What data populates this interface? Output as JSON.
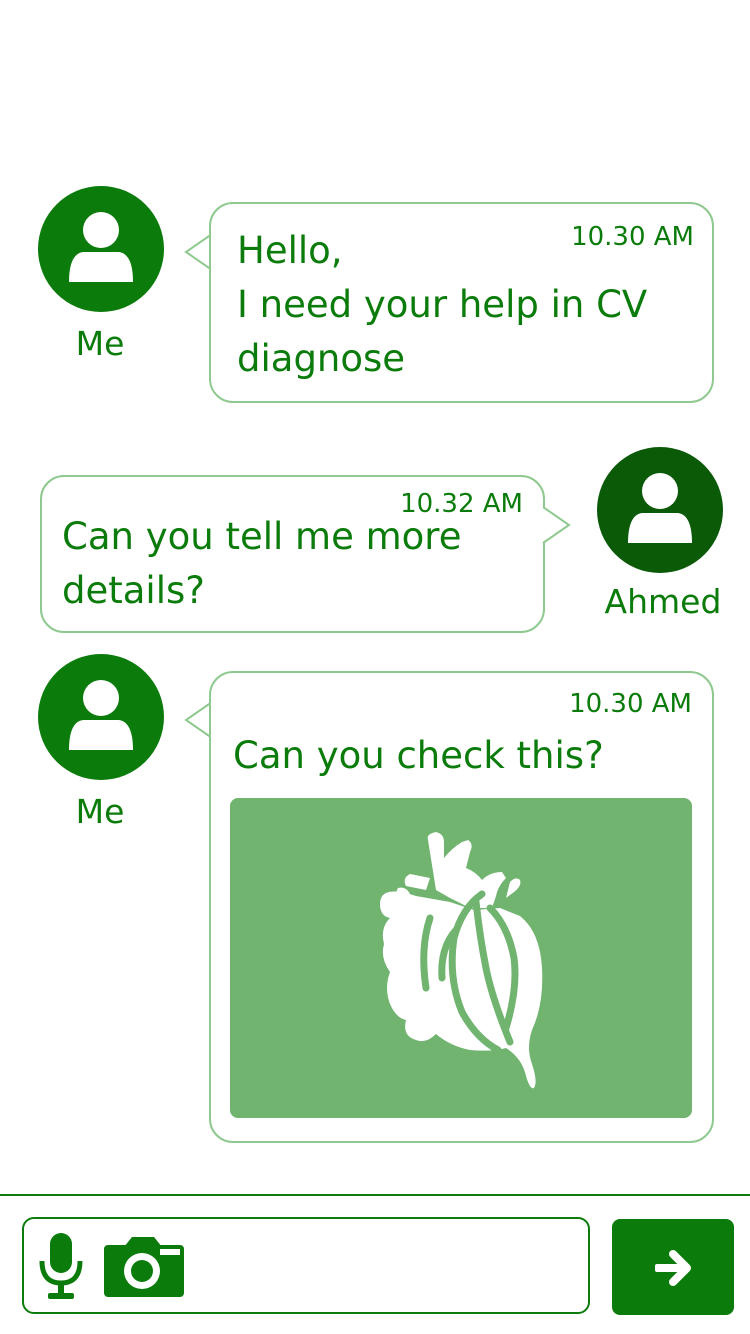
{
  "messages": [
    {
      "sender": "Me",
      "time": "10.30 AM",
      "text": "Hello,\nI need your help in CV\ndiagnose"
    },
    {
      "sender": "Ahmed",
      "time": "10.32 AM",
      "text": "Can you tell me more\ndetails?"
    },
    {
      "sender": "Me",
      "time": "10.30 AM",
      "text": "Can you check this?",
      "attachment_icon": "heart-anatomy-icon"
    }
  ],
  "composer": {
    "mic_icon": "microphone-icon",
    "camera_icon": "camera-icon",
    "send_icon": "arrow-right-icon"
  },
  "colors": {
    "primary": "#0b7c0b",
    "avatar_dark": "#0a5a08",
    "bubble_border": "#8fc98f",
    "image_bg": "#70b470"
  }
}
